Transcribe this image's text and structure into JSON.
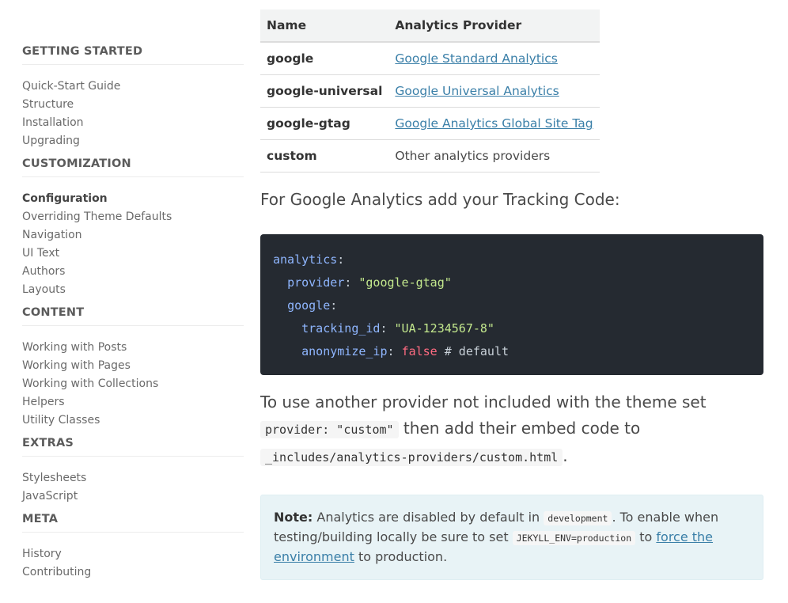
{
  "sidebar": {
    "sections": [
      {
        "title": "GETTING STARTED",
        "items": [
          "Quick-Start Guide",
          "Structure",
          "Installation",
          "Upgrading"
        ]
      },
      {
        "title": "CUSTOMIZATION",
        "items": [
          "Configuration",
          "Overriding Theme Defaults",
          "Navigation",
          "UI Text",
          "Authors",
          "Layouts"
        ]
      },
      {
        "title": "CONTENT",
        "items": [
          "Working with Posts",
          "Working with Pages",
          "Working with Collections",
          "Helpers",
          "Utility Classes"
        ]
      },
      {
        "title": "EXTRAS",
        "items": [
          "Stylesheets",
          "JavaScript"
        ]
      },
      {
        "title": "META",
        "items": [
          "History",
          "Contributing"
        ]
      }
    ],
    "active_item": "Configuration"
  },
  "table": {
    "headers": [
      "Name",
      "Analytics Provider"
    ],
    "rows": [
      {
        "name": "google",
        "provider": "Google Standard Analytics",
        "is_link": true
      },
      {
        "name": "google-universal",
        "provider": "Google Universal Analytics",
        "is_link": true
      },
      {
        "name": "google-gtag",
        "provider": "Google Analytics Global Site Tag",
        "is_link": true
      },
      {
        "name": "custom",
        "provider": "Other analytics providers",
        "is_link": false
      }
    ]
  },
  "lead": "For Google Analytics add your Tracking Code:",
  "code": {
    "analytics_key": "analytics",
    "provider_key": "provider",
    "provider_value": "\"google-gtag\"",
    "google_key": "google",
    "tracking_key": "tracking_id",
    "tracking_value": "\"UA-1234567-8\"",
    "anonymize_key": "anonymize_ip",
    "anonymize_value": "false",
    "comment": "# default"
  },
  "para": {
    "text1": "To use another provider not included with the theme set",
    "code1": "provider: \"custom\"",
    "text2": "then add their embed code to",
    "code2": "_includes/analytics-providers/custom.html",
    "text3": "."
  },
  "note": {
    "label": "Note:",
    "text1": "Analytics are disabled by default in",
    "code1": "development",
    "text2": ". To enable when testing/building locally be sure to set",
    "code2": "JEKYLL_ENV=production",
    "text3": "to",
    "link": "force the environment",
    "text4": "to production."
  },
  "colors": {
    "link": "#3a7fa8",
    "code_bg": "#252a31",
    "note_bg": "#e8f3f6"
  }
}
